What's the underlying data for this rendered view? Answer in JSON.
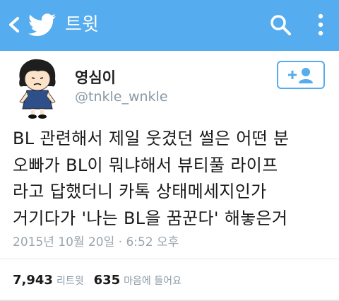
{
  "header": {
    "title": "트윗",
    "back_icon": "back-chevron-icon",
    "logo_icon": "twitter-bird-icon",
    "search_icon": "search-icon",
    "more_icon": "more-vertical-icon",
    "bg_color": "#55acee"
  },
  "author": {
    "name": "영심이",
    "handle": "@tnkle_wnkle",
    "avatar_icon": "cartoon-girl-avatar",
    "follow_icon": "add-user-icon"
  },
  "tweet": {
    "lines": [
      "BL 관련해서 제일 웃겼던 썰은 어떤 분",
      "오빠가 BL이 뭐냐해서 뷰티풀 라이프",
      "라고 답했더니 카톡 상태메세지인가",
      "거기다가 '나는 BL을 꿈꾼다' 해놓은거"
    ],
    "timestamp": "2015년 10월 20일 · 6:52 오후"
  },
  "stats": {
    "retweets_count": "7,943",
    "retweets_label": "리트윗",
    "likes_count": "635",
    "likes_label": "마음에 들어요"
  }
}
